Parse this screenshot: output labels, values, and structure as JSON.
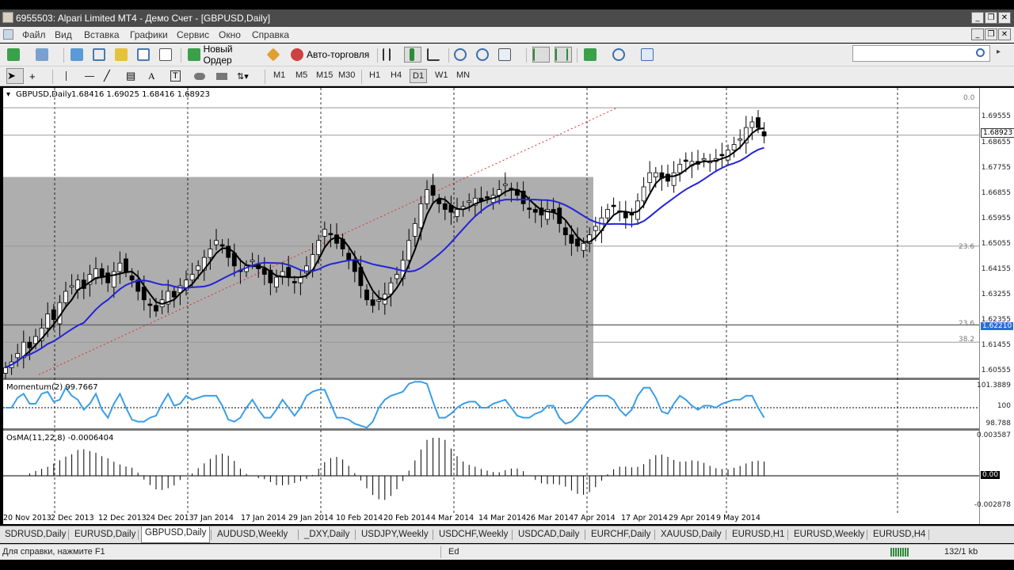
{
  "window": {
    "title": "6955503: Alpari Limited MT4 - Демо Счет - [GBPUSD,Daily]"
  },
  "menu": [
    "Файл",
    "Вид",
    "Вставка",
    "Графики",
    "Сервис",
    "Окно",
    "Справка"
  ],
  "toolbar": {
    "new_order": "Новый Ордер",
    "auto_trading": "Авто-торговля"
  },
  "timeframes": [
    "M1",
    "M5",
    "M15",
    "M30",
    "H1",
    "H4",
    "D1",
    "W1",
    "MN"
  ],
  "active_timeframe": "D1",
  "chart": {
    "symbol_label": "GBPUSD,Daily",
    "ohlc": "1.68416 1.69025 1.68416 1.68923",
    "current_price": "1.68923",
    "highlight_price": "1.62210",
    "fib_labels": [
      "0.0",
      "23.6",
      "23.6",
      "38.2"
    ],
    "momentum_label": "Momentum(2) 99.7667",
    "osma_label": "OsMA(11,22,8) -0.0006404",
    "momentum_scale": [
      "101.3889",
      "100",
      "98.788"
    ],
    "osma_scale": [
      "0.003587",
      "0.00",
      "-0.002878"
    ],
    "date_labels": [
      "20 Nov 2013",
      "2 Dec 2013",
      "12 Dec 2013",
      "24 Dec 2013",
      "7 Jan 2014",
      "17 Jan 2014",
      "29 Jan 2014",
      "10 Feb 2014",
      "20 Feb 2014",
      "4 Mar 2014",
      "14 Mar 2014",
      "26 Mar 2014",
      "7 Apr 2014",
      "17 Apr 2014",
      "29 Apr 2014",
      "9 May 2014"
    ],
    "colors": {
      "candle": "#000000",
      "ma_fast": "#000000",
      "ma_slow": "#2424d6",
      "momentum": "#3a9ee6",
      "rect": "#a0a0a0",
      "trend": "#e03030"
    }
  },
  "chart_data": {
    "type": "candlestick",
    "symbol": "GBPUSD",
    "price_axis_ticks": [
      1.69555,
      1.68655,
      1.67755,
      1.66855,
      1.65955,
      1.65055,
      1.64155,
      1.63255,
      1.62355,
      1.61455,
      1.60555
    ],
    "ylim": [
      1.604,
      1.701
    ],
    "close_series": [
      1.607,
      1.609,
      1.612,
      1.616,
      1.614,
      1.618,
      1.621,
      1.626,
      1.624,
      1.63,
      1.634,
      1.636,
      1.638,
      1.635,
      1.64,
      1.642,
      1.639,
      1.637,
      1.641,
      1.644,
      1.641,
      1.638,
      1.634,
      1.631,
      1.629,
      1.627,
      1.631,
      1.634,
      1.632,
      1.636,
      1.638,
      1.64,
      1.643,
      1.646,
      1.649,
      1.652,
      1.65,
      1.646,
      1.643,
      1.641,
      1.643,
      1.645,
      1.642,
      1.64,
      1.637,
      1.639,
      1.641,
      1.639,
      1.637,
      1.639,
      1.643,
      1.647,
      1.652,
      1.656,
      1.654,
      1.651,
      1.649,
      1.645,
      1.641,
      1.636,
      1.631,
      1.629,
      1.631,
      1.633,
      1.637,
      1.64,
      1.645,
      1.652,
      1.658,
      1.665,
      1.67,
      1.668,
      1.665,
      1.663,
      1.662,
      1.663,
      1.664,
      1.666,
      1.667,
      1.666,
      1.667,
      1.668,
      1.67,
      1.672,
      1.67,
      1.668,
      1.665,
      1.663,
      1.662,
      1.661,
      1.663,
      1.662,
      1.658,
      1.654,
      1.651,
      1.65,
      1.651,
      1.654,
      1.657,
      1.66,
      1.663,
      1.664,
      1.662,
      1.66,
      1.661,
      1.666,
      1.671,
      1.676,
      1.676,
      1.674,
      1.673,
      1.676,
      1.679,
      1.68,
      1.68,
      1.679,
      1.681,
      1.68,
      1.681,
      1.682,
      1.684,
      1.686,
      1.688,
      1.692,
      1.694,
      1.692,
      1.689
    ],
    "indicators": [
      "Momentum(2)",
      "OsMA(11,22,8)"
    ],
    "momentum_last": 99.7667,
    "osma_last": -0.0006404
  },
  "tabs": [
    "SDRUSD,Daily",
    "EURUSD,Daily",
    "GBPUSD,Daily",
    "AUDUSD,Weekly",
    "_DXY,Daily",
    "USDJPY,Weekly",
    "USDCHF,Weekly",
    "USDCAD,Daily",
    "EURCHF,Daily",
    "XAUUSD,Daily",
    "EURUSD,H1",
    "EURUSD,Weekly",
    "EURUSD,H4"
  ],
  "active_tab": "GBPUSD,Daily",
  "status": {
    "help": "Для справки, нажмите F1",
    "profile": "Ed",
    "traffic": "132/1 kb"
  }
}
